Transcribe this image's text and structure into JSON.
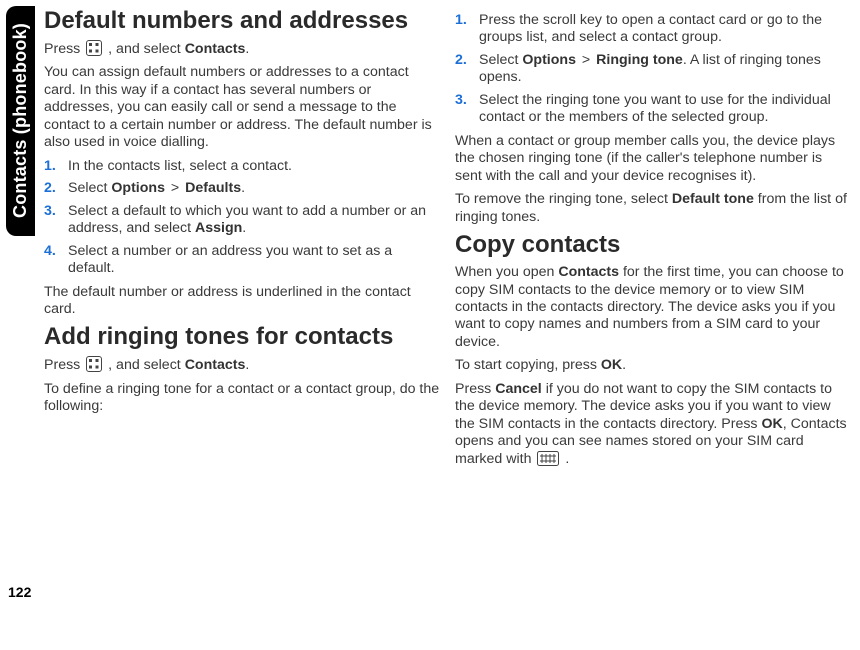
{
  "chapter": {
    "title": "Contacts (phonebook)"
  },
  "page_number": "122",
  "col1": {
    "h1_default": "Default numbers and addresses",
    "default_intro_a": "Press ",
    "default_intro_b": " , and select ",
    "contacts_label": "Contacts",
    "default_intro_c": ".",
    "default_para": "You can assign default numbers or addresses to a contact card. In this way if a contact has several numbers or addresses, you can easily call or send a message to the contact to a certain number or address. The default number is also used in voice dialling.",
    "steps_default": {
      "s1": "In the contacts list, select a contact.",
      "s2a": "Select ",
      "s2_options": "Options",
      "s2_gt": " > ",
      "s2_defaults": "Defaults",
      "s2b": ".",
      "s3a": "Select a default to which you want to add a number or an address, and select ",
      "s3_assign": "Assign",
      "s3b": ".",
      "s4": "Select a number or an address you want to set as a default."
    },
    "default_after": "The default number or address is underlined in the contact card.",
    "h1_ring": "Add ringing tones for contacts",
    "ring_intro_a": "Press ",
    "ring_intro_b": " , and select ",
    "ring_intro_c": ".",
    "ring_para": "To define a ringing tone for a contact or a contact group, do the following:"
  },
  "col2": {
    "steps_ring": {
      "s1": "Press the scroll key to open a contact card or go to the groups list, and select a contact group.",
      "s2a": "Select ",
      "s2_options": "Options",
      "s2_gt": " > ",
      "s2_ringtone": "Ringing tone",
      "s2b": ". A list of ringing tones opens.",
      "s3": "Select the ringing tone you want to use for the individual contact or the members of the selected group."
    },
    "ring_after": "When a contact or group member calls you, the device plays the chosen ringing tone (if the caller's telephone number is sent with the call and your device recognises it).",
    "ring_remove_a": "To remove the ringing tone, select ",
    "ring_remove_bold": "Default tone",
    "ring_remove_b": " from the list of ringing tones.",
    "h1_copy": "Copy contacts",
    "copy_p1_a": "When you open ",
    "copy_p1_bold": "Contacts",
    "copy_p1_b": " for the first time, you can choose to copy SIM contacts to the device memory or to view SIM contacts in the contacts directory. The device asks you if you want to copy names and numbers from a SIM card to your device.",
    "copy_p2_a": "To start copying, press ",
    "ok_label": "OK",
    "copy_p2_b": ".",
    "copy_p3_a": "Press ",
    "cancel_label": "Cancel",
    "copy_p3_b": " if you do not want to copy the SIM contacts to the device memory. The device asks you if you want to view the SIM contacts in the contacts directory. Press ",
    "copy_p3_c": ", Contacts opens and you can see names stored on your SIM card marked with ",
    "copy_p3_d": "."
  },
  "icons": {
    "menu_key": "menu-key-icon",
    "sim_card": "sim-card-icon"
  }
}
